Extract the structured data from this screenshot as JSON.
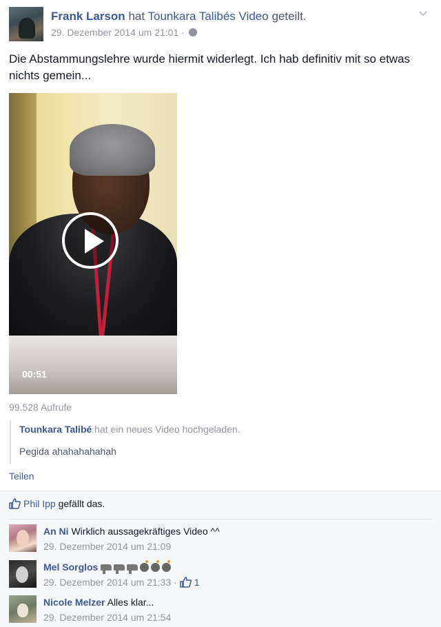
{
  "post": {
    "author": "Frank Larson",
    "action_prefix": "hat",
    "shared_from": "Tounkara Talibés",
    "video_word": "Video",
    "action_suffix": "geteilt.",
    "timestamp": "29. Dezember 2014 um 21:01",
    "meta_separator": "·",
    "privacy_icon": "globe-icon",
    "text": "Die Abstammungslehre wurde hiermit widerlegt. Ich hab definitiv mit so etwas nichts gemein...",
    "video": {
      "duration": "00:51",
      "play_icon": "play-icon"
    },
    "views": "99.528 Aufrufe",
    "shared_post": {
      "author": "Tounkara Talibé",
      "action_prefix": "hat ein neues",
      "video_word": "Video",
      "action_suffix": "hochgeladen.",
      "text": "Pegida ahahahahahah"
    },
    "share_label": "Teilen"
  },
  "footer": {
    "likes": {
      "icon": "thumbs-up-icon",
      "liker": "Phil Ipp",
      "text": "gefällt das."
    },
    "comments": [
      {
        "name": "An Ni",
        "text": "Wirklich aussagekräftiges Video ^^",
        "timestamp": "29. Dezember 2014 um 21:09"
      },
      {
        "name": "Mel Sorglos",
        "text": "",
        "emoji": [
          "gun",
          "gun",
          "gun",
          "bomb",
          "bomb",
          "bomb"
        ],
        "timestamp": "29. Dezember 2014 um 21:33",
        "separator": "·",
        "like_count": "1"
      },
      {
        "name": "Nicole Melzer",
        "text": "Alles klar...",
        "timestamp": "29. Dezember 2014 um 21:54"
      }
    ]
  },
  "colors": {
    "link": "#3b5998",
    "meta": "#90949c",
    "footer_bg": "#f6f7f9"
  }
}
